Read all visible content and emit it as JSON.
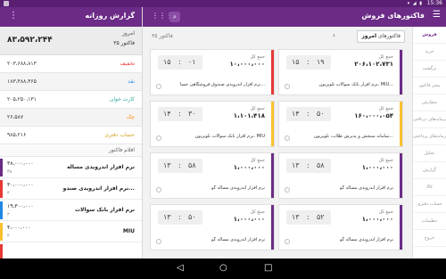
{
  "status_bar": {
    "time": "15:36",
    "icons": "▾ ◢ ▮"
  },
  "left_panel": {
    "title": "گزارش روزانه",
    "summary": {
      "today": "امروز",
      "invoice_count": "۳۵ فاکتور",
      "total": "۸۳،۵۹۲،۲۴۴"
    },
    "metrics": [
      {
        "label": "تخفیف",
        "value": "۲۰۳،۶۸۸،۸۱۳",
        "color": "#e53935"
      },
      {
        "label": "نقد",
        "value": "۱۸۳،۴۸۸،۴۶۵",
        "color": "#1e88e5"
      },
      {
        "label": "کارت خوان",
        "value": "۲۰۵،۲۵۰،۱۳۱",
        "color": "#26a69a"
      },
      {
        "label": "چک",
        "value": "۲۶،۵۸۷",
        "color": "#fb8c00"
      },
      {
        "label": "حساب دفتری",
        "value": "۹۸۵،۲۱۶",
        "color": "#d4a017"
      }
    ],
    "items_title": "اقلام فاکتور",
    "items": [
      {
        "name": "نرم افزار اندرویدی مساله",
        "amount": "۳۸،۰۰۰،۰۰۰",
        "qty": "۳۸",
        "color": "#6b2b87"
      },
      {
        "name": "نرم افزار اندرویدی صندو...",
        "amount": "۳۰،۰۰۰،۰۰۰",
        "qty": "۳",
        "color": "#e53935"
      },
      {
        "name": "نرم افزار بانک سوالات",
        "amount": "۱۹،۳۰۰،۰۰۰",
        "qty": "۳",
        "color": "#1e88e5"
      },
      {
        "name": "MIU",
        "amount": "۴،۰۰۰،۰۰۰",
        "qty": "۴",
        "color": "#fbc02d"
      },
      {
        "name": "",
        "amount": "",
        "qty": "",
        "color": "#e53935"
      }
    ]
  },
  "main_header": {
    "title": "فاکتورهای فروش",
    "menu_icon": "☰",
    "search_icon": "⌕",
    "grid_icon": "⋮⋮⋮"
  },
  "sub_header": {
    "count": "۳۵ فاکتور",
    "filter_label": "فاکتورهای",
    "filter_value": "امروز",
    "chevron": "‹"
  },
  "side_menu": [
    {
      "label": "فروش",
      "active": true
    },
    {
      "label": "خرید",
      "active": false
    },
    {
      "label": "برگشت",
      "active": false
    },
    {
      "label": "پیش فاکتور",
      "active": false
    },
    {
      "label": "سفارش",
      "active": false
    },
    {
      "label": "سرمایه‌های دریافتی",
      "active": false
    },
    {
      "label": "سرمایه‌های پرداختی",
      "active": false
    },
    {
      "label": "تحلیل",
      "active": false
    },
    {
      "label": "گزارش",
      "active": false
    },
    {
      "label": "کالا",
      "active": false
    },
    {
      "label": "حساب دفتری",
      "active": false
    },
    {
      "label": "تنظیمات",
      "active": false
    },
    {
      "label": "خروج",
      "active": false
    }
  ],
  "cards": [
    {
      "total_label": "جمع کل",
      "total": "۲۰۶،۱۰۲،۷۳۱",
      "hour": "۱۵",
      "minute": "۱۹",
      "desc": "نرم افزار بانک سوالات تلویزیون، MIU...",
      "color": "#6b2b87"
    },
    {
      "total_label": "جمع کل",
      "total": "۱۰،۰۰۰،۰۰۰",
      "hour": "۱۵",
      "minute": "۰۱",
      "desc": "نرم افزار اندرویدی صندوق فروشگاهی حسا...",
      "color": "#e53935"
    },
    {
      "total_label": "جمع کل",
      "total": "۱۶۰،۰۰۰،۰۵۴",
      "hour": "۱۴",
      "minute": "۵۰",
      "desc": "سامانه سنجش و پذیرش طلاب، تلویزیون...",
      "color": "#fbc02d"
    },
    {
      "total_label": "جمع کل",
      "total": "۱،۱۰۱،۴۱۸",
      "hour": "۱۴",
      "minute": "۳۰",
      "desc": "نرم افزار بانک سوالات تلویزیون، MIU",
      "color": "#fbc02d"
    },
    {
      "total_label": "جمع کل",
      "total": "۱،۰۰۰،۰۰۰",
      "hour": "۱۳",
      "minute": "۵۸",
      "desc": "نرم افزار اندرویدی مساله گو",
      "color": "#6b2b87"
    },
    {
      "total_label": "جمع کل",
      "total": "۱،۰۰۰،۰۰۰",
      "hour": "۱۳",
      "minute": "۵۸",
      "desc": "نرم افزار اندرویدی مساله گو",
      "color": "#6b2b87"
    },
    {
      "total_label": "جمع کل",
      "total": "۱،۰۰۰،۰۰۰",
      "hour": "۱۳",
      "minute": "۵۲",
      "desc": "نرم افزار اندرویدی مساله گو",
      "color": "#6b2b87"
    },
    {
      "total_label": "جمع کل",
      "total": "۱،۰۰۰،۰۰۰",
      "hour": "۱۳",
      "minute": "۵۰",
      "desc": "نرم افزار اندرویدی مساله گو",
      "color": "#6b2b87"
    }
  ],
  "navbar": {
    "back": "◁",
    "home": "○",
    "recents": "□"
  }
}
